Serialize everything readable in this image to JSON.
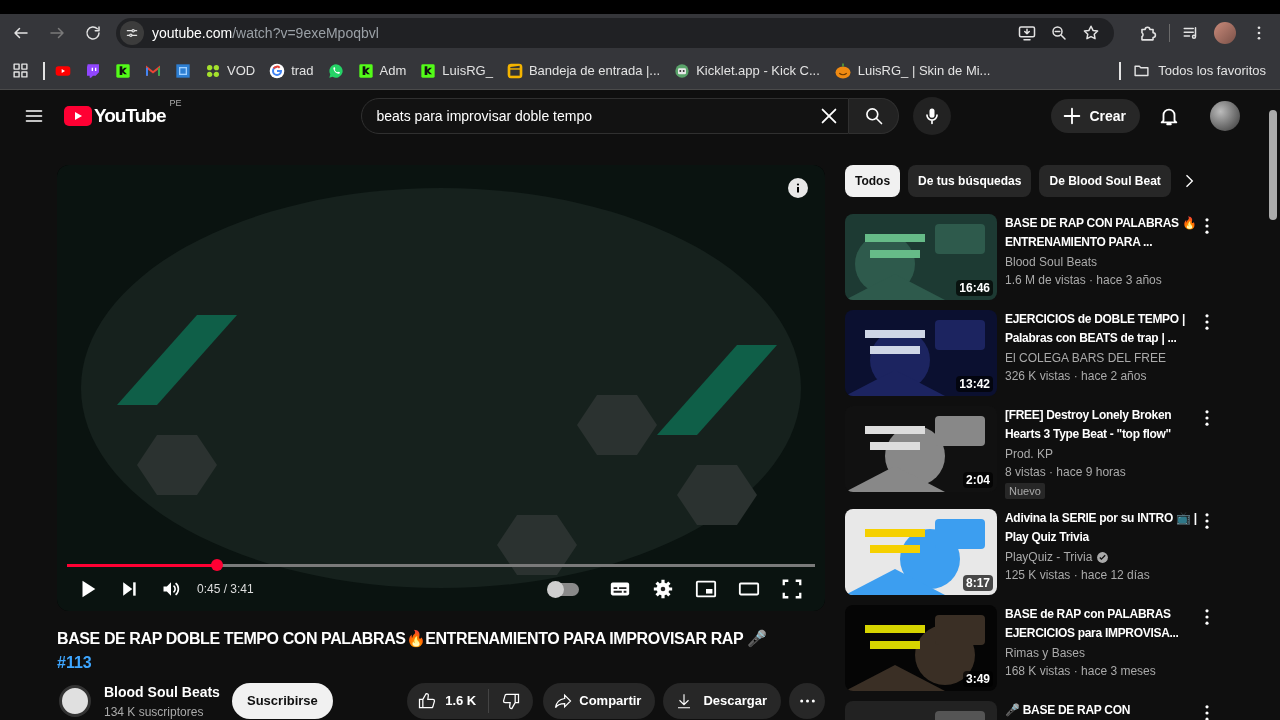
{
  "browser": {
    "back_enabled": true,
    "forward_enabled": false,
    "url_host": "youtube.com",
    "url_path": "/watch?v=9exeMpoqbvl",
    "bookmarks": [
      {
        "kind": "youtube"
      },
      {
        "kind": "twitch"
      },
      {
        "kind": "kick"
      },
      {
        "kind": "gmail"
      },
      {
        "kind": "frame"
      },
      {
        "kind": "flower",
        "label": "VOD"
      },
      {
        "kind": "google",
        "label": "trad"
      },
      {
        "kind": "whatsapp"
      },
      {
        "kind": "kick",
        "label": "Adm"
      },
      {
        "kind": "kick",
        "label": "LuisRG_"
      },
      {
        "kind": "clapper",
        "label": "Bandeja de entrada |..."
      },
      {
        "kind": "robot",
        "label": "Kicklet.app - Kick C..."
      },
      {
        "kind": "pumpkin",
        "label": "LuisRG_ | Skin de Mi..."
      }
    ],
    "all_bookmarks": "Todos los favoritos"
  },
  "masthead": {
    "logo": "YouTube",
    "country": "PE",
    "search": "beats para improvisar doble tempo",
    "create": "Crear"
  },
  "player": {
    "time": "0:45 / 3:41",
    "level": 0.2,
    "autoplay_on": false
  },
  "video": {
    "title": "BASE DE RAP DOBLE TEMPO CON PALABRAS🔥ENTRENAMIENTO PARA IMPROVISAR RAP 🎤",
    "hashtag": "#113",
    "channel": "Blood Soul Beats",
    "subscribers": "134 K suscriptores",
    "subscribe": "Suscribirse",
    "likes": "1.6 K",
    "share": "Compartir",
    "download": "Descargar"
  },
  "chips": [
    {
      "label": "Todos",
      "selected": true
    },
    {
      "label": "De tus búsquedas",
      "selected": false
    },
    {
      "label": "De Blood Soul Beat",
      "selected": false
    }
  ],
  "related": [
    {
      "title": "BASE DE RAP CON PALABRAS 🔥ENTRENAMIENTO PARA ...",
      "channel": "Blood Soul Beats",
      "stats": "1.6 M de vistas · hace 3 años",
      "duration": "16:46",
      "verified": false
    },
    {
      "title": "EJERCICIOS de DOBLE TEMPO | Palabras con BEATS de trap | ...",
      "channel": "El COLEGA BARS DEL FREE",
      "stats": "326 K vistas · hace 2 años",
      "duration": "13:42",
      "verified": false
    },
    {
      "title": "[FREE] Destroy Lonely Broken Hearts 3 Type Beat - \"top flow\"",
      "channel": "Prod. KP",
      "stats": "8 vistas · hace 9 horas",
      "duration": "2:04",
      "badge": "Nuevo",
      "verified": false
    },
    {
      "title": "Adivina la SERIE por su INTRO 📺 | Play Quiz Trivia",
      "channel": "PlayQuiz - Trivia",
      "stats": "125 K vistas · hace 12 días",
      "duration": "8:17",
      "verified": true
    },
    {
      "title": "BASE de RAP con PALABRAS EJERCICIOS para IMPROVISA...",
      "channel": "Rimas y Bases",
      "stats": "168 K vistas · hace 3 meses",
      "duration": "3:49",
      "verified": false
    },
    {
      "title": "🎤 BASE DE RAP CON",
      "verified": false
    }
  ]
}
